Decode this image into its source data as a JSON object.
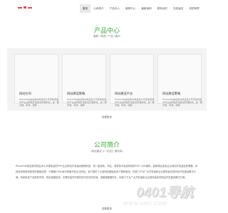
{
  "nav": {
    "items": [
      "首页",
      "公司简介",
      "产品中心",
      "新闻中心",
      "最新案例",
      "联系我们",
      "在线留言",
      "资质荣誉"
    ]
  },
  "products": {
    "title": "产品中心",
    "subtitle": "- 最新 / 精选 / 产品 / 展示 -",
    "cards": [
      {
        "title": "网站空间",
        "desc": "PbootCMS是全新内核且永久开源免费的PHP企业网站开发建设管理系统，是一套高效、简洁、强悍…"
      },
      {
        "title": "网站建设策略",
        "desc": "PbootCMS是全新内核且永久开源免费的PHP企业网站开发建设管理系统，是一套高效、简洁、强悍…"
      },
      {
        "title": "网站建设平台",
        "desc": "PbootCMS是全新内核且永久开源免费的PHP企业网站开发建设管理系统，是一套高效、简洁、强悍…"
      },
      {
        "title": "网站建设策略",
        "desc": "PbootCMS是全新内核且永久开源免费的PHP企业网站开发建设管理系统，是一套高效、简洁、强悍…"
      }
    ],
    "more": "查看更多"
  },
  "about": {
    "title": "公司简介",
    "subtitle": "- 网站建设【一站式】服务商 -",
    "body": "PbootCMS是全新内核且永久开源免费的PHP企业网站开发建设管理系统，是一套高效、简洁、强悍的可免费商用的PHP CMS源码，能够满足各类企业网站开发建设的需要。系统采用简单到想哭的模板标签，只要懂HTML就可快速开发企业网站。官方提供了大量网站模板免费下载和使用，将致力于为广大开发者和企业提供最佳的网站开发建设解决方案。系统采用了高效的内核，响应速度极快，无需安装任何插件即可实现手机端、电脑端数据同步，将致力于为广大开发者和企业提供最佳的网站开发建设解决方案。",
    "more": "查看更多"
  },
  "watermark": {
    "text": "0401导航",
    "sub": "WWW.0401.COM"
  }
}
